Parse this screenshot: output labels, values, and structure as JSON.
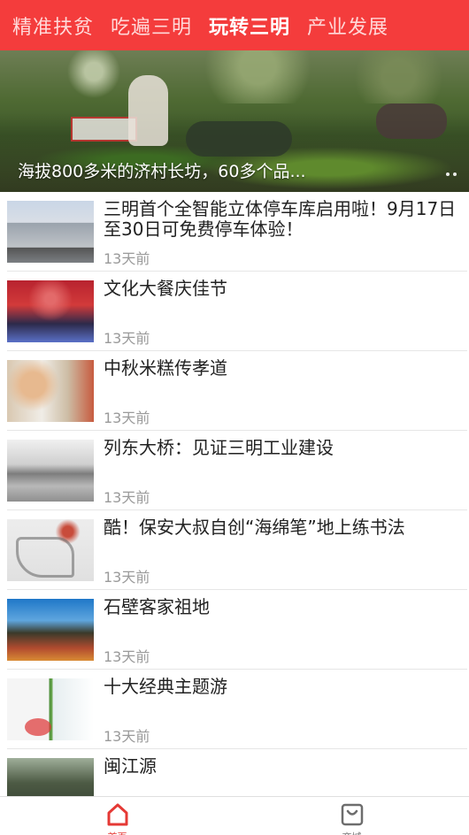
{
  "colors": {
    "accent": "#f43c3c",
    "tab_inactive": "#ffd9d9",
    "time_gray": "#9a9a9a",
    "home_active": "#e53935",
    "shop_icon": "#6d6d6d"
  },
  "tabs": [
    {
      "label": "精准扶贫",
      "active": false
    },
    {
      "label": "吃遍三明",
      "active": false
    },
    {
      "label": "玩转三明",
      "active": true
    },
    {
      "label": "产业发展",
      "active": false
    }
  ],
  "banner": {
    "caption": "海拔800多米的济村长坊，60多个品..."
  },
  "articles": [
    {
      "title": "三明首个全智能立体停车库启用啦！9月17日至30日可免费停车体验！",
      "time": "13天前"
    },
    {
      "title": "文化大餐庆佳节",
      "time": "13天前"
    },
    {
      "title": "中秋米糕传孝道",
      "time": "13天前"
    },
    {
      "title": "列东大桥：见证三明工业建设",
      "time": "13天前"
    },
    {
      "title": "酷！保安大叔自创“海绵笔”地上练书法",
      "time": "13天前"
    },
    {
      "title": "石壁客家祖地",
      "time": "13天前"
    },
    {
      "title": "十大经典主题游",
      "time": "13天前"
    },
    {
      "title": "闽江源",
      "time": ""
    }
  ],
  "bottom_nav": {
    "home": {
      "label": "首页",
      "icon": "home-icon"
    },
    "shop": {
      "label": "商城",
      "icon": "shopping-bag-icon"
    }
  }
}
